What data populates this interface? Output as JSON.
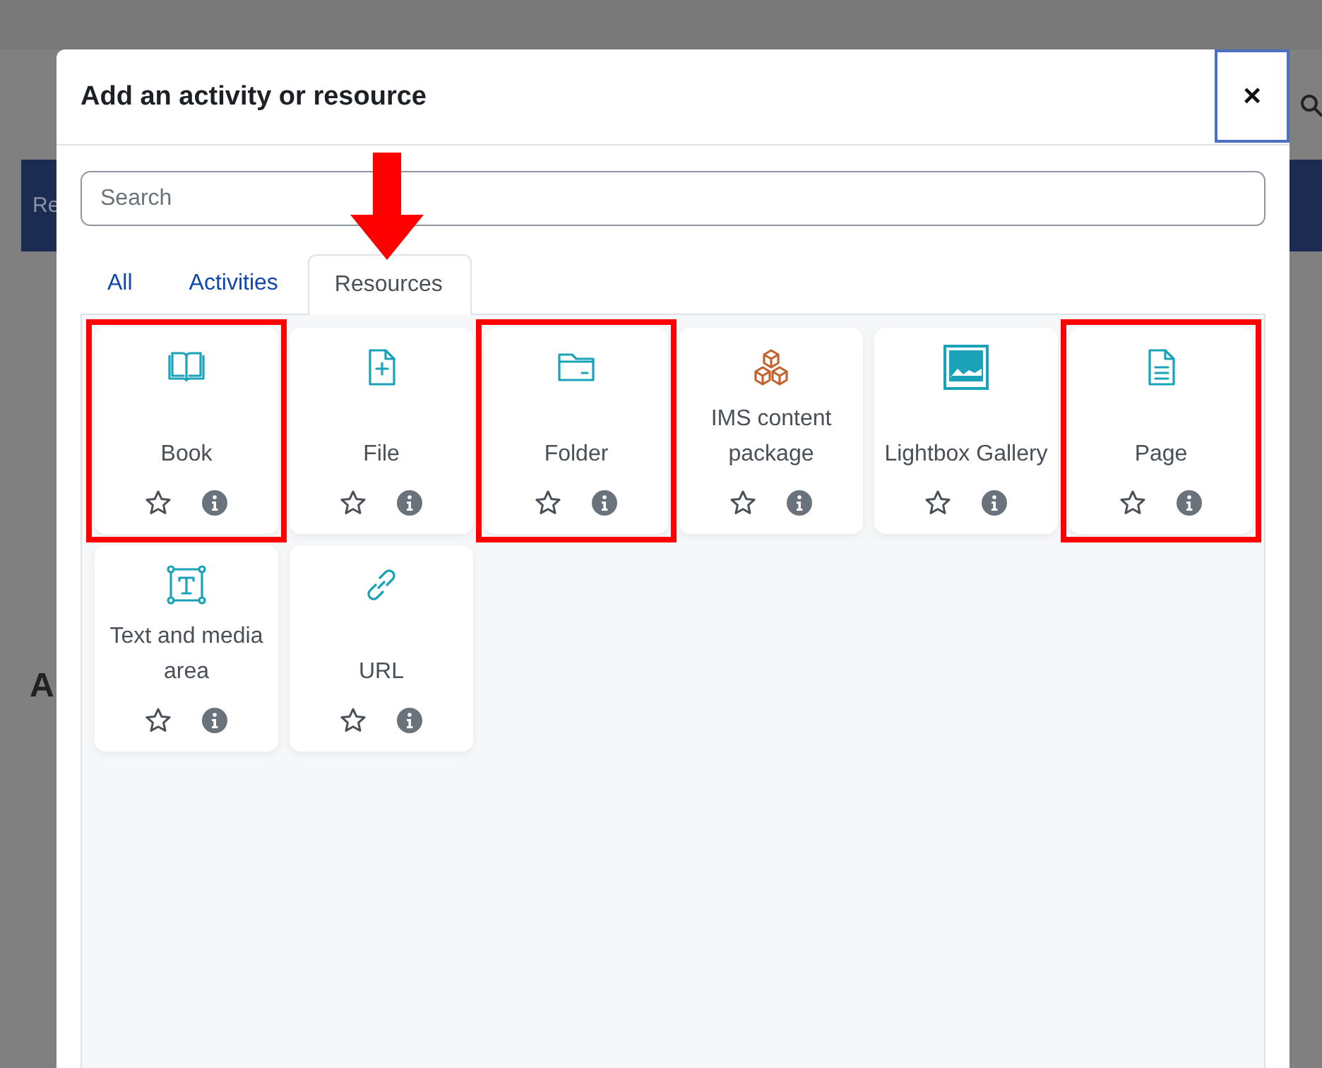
{
  "background_page": {
    "nav_text": "Re",
    "heading_text": "A"
  },
  "dialog": {
    "title": "Add an activity or resource",
    "close": "×"
  },
  "search": {
    "placeholder": "Search"
  },
  "tabs": [
    {
      "label": "All",
      "selected": false,
      "arrow": false
    },
    {
      "label": "Activities",
      "selected": false,
      "arrow": false
    },
    {
      "label": "Resources",
      "selected": true,
      "arrow": true
    }
  ],
  "activities": [
    {
      "name": "Book",
      "kind": "book",
      "color": "#1aa3b8",
      "highlighted": true
    },
    {
      "name": "File",
      "kind": "file",
      "color": "#1aa3b8",
      "highlighted": false
    },
    {
      "name": "Folder",
      "kind": "folder",
      "color": "#1aa3b8",
      "highlighted": true
    },
    {
      "name": "IMS content package",
      "kind": "cubes",
      "color": "#c4622d",
      "highlighted": false
    },
    {
      "name": "Lightbox Gallery",
      "kind": "gallery",
      "color": "#1aa3b8",
      "highlighted": false
    },
    {
      "name": "Page",
      "kind": "page",
      "color": "#1aa3b8",
      "highlighted": true
    },
    {
      "name": "Text and media area",
      "kind": "textbox",
      "color": "#1aa3b8",
      "highlighted": false
    },
    {
      "name": "URL",
      "kind": "link",
      "color": "#1aa3b8",
      "highlighted": false
    }
  ]
}
